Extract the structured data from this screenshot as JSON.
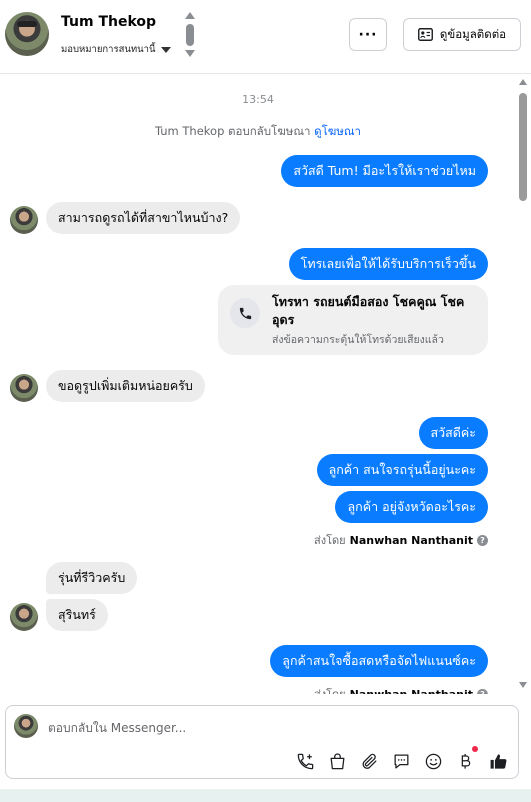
{
  "header": {
    "contact_name": "Tum Thekop",
    "assign_label": "มอบหมายการสนทนานี้",
    "more_label": "···",
    "contact_info_label": "ดูข้อมูลติดต่อ"
  },
  "conversation": {
    "timestamp": "13:54",
    "replied_text": "Tum Thekop ตอบกลับโฆษณา",
    "replied_link": "ดูโฆษณา",
    "messages": [
      {
        "text": "สวัสดี Tum! มีอะไรให้เราช่วยไหม"
      },
      {
        "text": "สามารถดูรถได้ที่สาขาไหนบ้าง?"
      },
      {
        "text": "โทรเลยเพื่อให้ได้รับบริการเร็วขึ้น"
      },
      {
        "text": "ขอดูรูปเพิ่มเติมหน่อยครับ"
      },
      {
        "text": "สวัสดีค่ะ"
      },
      {
        "text": "ลูกค้า สนใจรถรุ่นนี้อยู่นะคะ"
      },
      {
        "text": "ลูกค้า อยู่จังหวัดอะไรคะ"
      },
      {
        "text": "รุ่นที่รีวิวครับ"
      },
      {
        "text": "สุรินทร์"
      },
      {
        "text": "ลูกค้าสนใจซื้อสดหรือจัดไฟแนนซ์คะ"
      }
    ],
    "call_card": {
      "title": "โทรหา รถยนต์มือสอง โชคคูณ โชค อุดร",
      "subtitle": "ส่งข้อความกระตุ้นให้โทรด้วยเสียงแล้ว"
    },
    "sent_by_label": "ส่งโดย",
    "sent_by_name": "Nanwhan Nanthanit"
  },
  "composer": {
    "placeholder": "ตอบกลับใน Messenger..."
  },
  "icons": {
    "header": [
      "more-icon",
      "contact-card-icon"
    ],
    "composer": [
      "phone-add-icon",
      "bag-icon",
      "paperclip-icon",
      "chat-icon",
      "emoji-icon",
      "baht-icon",
      "thumbs-up-icon"
    ]
  },
  "colors": {
    "outgoing_bubble": "#0a7cff",
    "incoming_bubble": "#ececec",
    "link": "#0866ff",
    "notification_dot": "#f02849"
  }
}
